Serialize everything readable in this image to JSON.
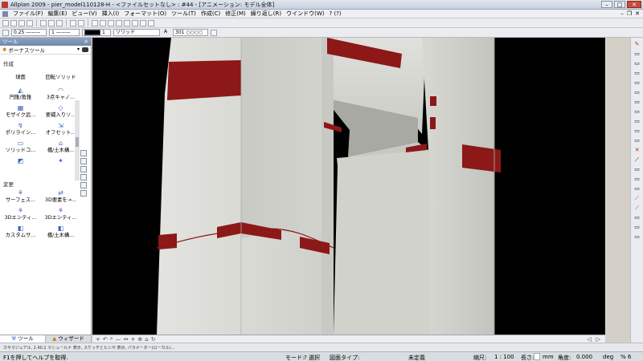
{
  "window": {
    "title": "Allplan 2009 - pier_model110128-H - <ファイルセットなし> : #44 - [アニメーション: モデル全体]",
    "controls": [
      "–",
      "□",
      "✕"
    ]
  },
  "menubar": {
    "items": [
      "ファイル(F)",
      "編集(E)",
      "ビュー(V)",
      "挿入(I)",
      "フォーマット(O)",
      "ツール(T)",
      "作成(C)",
      "修正(M)",
      "繰り返し(R)",
      "ウインドウ(W)",
      "? (?)"
    ],
    "mdi_controls": [
      "–",
      "❐",
      "✕"
    ]
  },
  "format_toolbar": {
    "pen": "0.25 ———",
    "line": "1 ———",
    "color": "1",
    "font": "ソリッド",
    "layer_icon": "A",
    "layer": "301 ○○○○"
  },
  "left_panel": {
    "header": "ツール",
    "toolset": "ボーナスツール",
    "section_create": "作成",
    "create_tools": [
      {
        "label": "球面",
        "icon": ""
      },
      {
        "label": "回転ソリッド",
        "icon": ""
      },
      {
        "label": "円錐/角錐",
        "icon": "◭"
      },
      {
        "label": "3点キャノ...",
        "icon": "◠"
      },
      {
        "label": "モザイク武...",
        "icon": "▦"
      },
      {
        "label": "要補入りソ...",
        "icon": "◇"
      },
      {
        "label": "ポリライン...",
        "icon": "↯"
      },
      {
        "label": "オフセット...",
        "icon": "⇲"
      },
      {
        "label": "ソリッドコ...",
        "icon": "▭"
      },
      {
        "label": "橋/土木構...",
        "icon": "⌂"
      },
      {
        "label": "",
        "icon": "◩"
      },
      {
        "label": "",
        "icon": "✦"
      }
    ],
    "section_modify": "変更",
    "modify_tools": [
      {
        "label": "サーフェス...",
        "icon": "⚘"
      },
      {
        "label": "3D要素を→...",
        "icon": "⇄"
      },
      {
        "label": "3Dエンティ...",
        "icon": "⚘"
      },
      {
        "label": "3Dエンティ...",
        "icon": "⚘"
      },
      {
        "label": "カスタムサ...",
        "icon": "◧"
      },
      {
        "label": "橋/土木構...",
        "icon": "◧"
      }
    ],
    "tabs": [
      "ツール",
      "ウィザード"
    ]
  },
  "viewport_toolbar": {
    "icons": [
      "+",
      "↶",
      "⌕",
      "—",
      "↔",
      "+",
      "⊕",
      "⌂",
      "↻",
      "◁",
      "▷"
    ]
  },
  "info_bar": {
    "text": "カサマジュアル, 2.40.1 マシュールナ 表示, スケッチとヒシサ 表示, パラメーター(ローカル)..."
  },
  "status_bar": {
    "help": "F1を押してヘルプを取得.",
    "mode_label": "モード:",
    "mode_value": "? 選択",
    "drawing_type_label": "図面タイプ:",
    "drawing_type_value": "未定義",
    "scale_label": "縮尺:",
    "scale_value": "1 : 100",
    "length_label": "長さ:",
    "length_unit": "mm",
    "angle_label": "角度:",
    "angle_value": "0.000",
    "angle_unit": "deg",
    "percent": "% 6"
  },
  "colors": {
    "concrete": "#d9d9d4",
    "stripe": "#8c1818",
    "background": "#000000",
    "panel_header": "#7f95b8"
  }
}
